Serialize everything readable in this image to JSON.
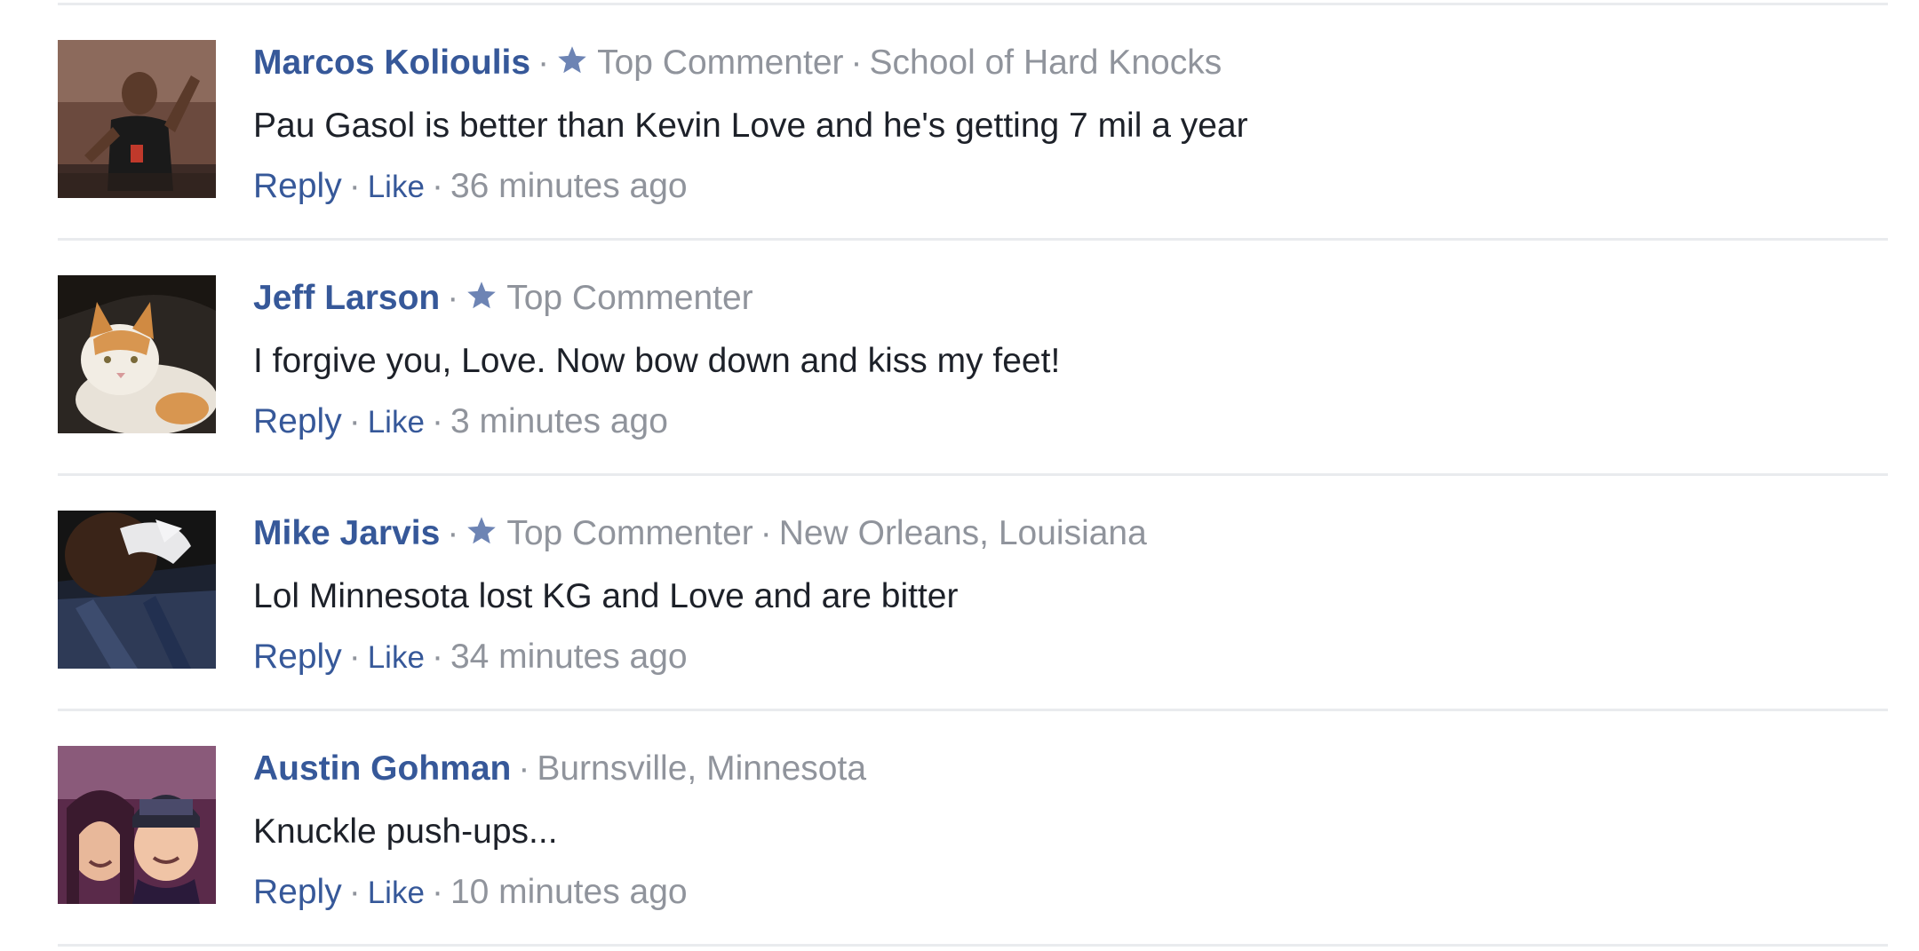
{
  "comments": [
    {
      "name": "Marcos Kolioulis",
      "badge": "Top Commenter",
      "location": "School of Hard Knocks",
      "text": "Pau Gasol is better than Kevin Love and he's getting 7 mil a year",
      "reply_label": "Reply",
      "like_label": "Like",
      "time": "36 minutes ago"
    },
    {
      "name": "Jeff Larson",
      "badge": "Top Commenter",
      "location": "",
      "text": "I forgive you, Love. Now bow down and kiss my feet!",
      "reply_label": "Reply",
      "like_label": "Like",
      "time": "3 minutes ago"
    },
    {
      "name": "Mike Jarvis",
      "badge": "Top Commenter",
      "location": "New Orleans, Louisiana",
      "text": "Lol Minnesota lost KG and Love and are bitter",
      "reply_label": "Reply",
      "like_label": "Like",
      "time": "34 minutes ago"
    },
    {
      "name": "Austin Gohman",
      "badge": "",
      "location": "Burnsville, Minnesota",
      "text": "Knuckle push-ups...",
      "reply_label": "Reply",
      "like_label": "Like",
      "time": "10 minutes ago"
    }
  ],
  "separator": "·",
  "colors": {
    "name_link": "#365899",
    "meta_text": "#90949c",
    "body_text": "#1d2129",
    "divider": "#e9ebee"
  },
  "icons": {
    "badge": "star-icon"
  }
}
